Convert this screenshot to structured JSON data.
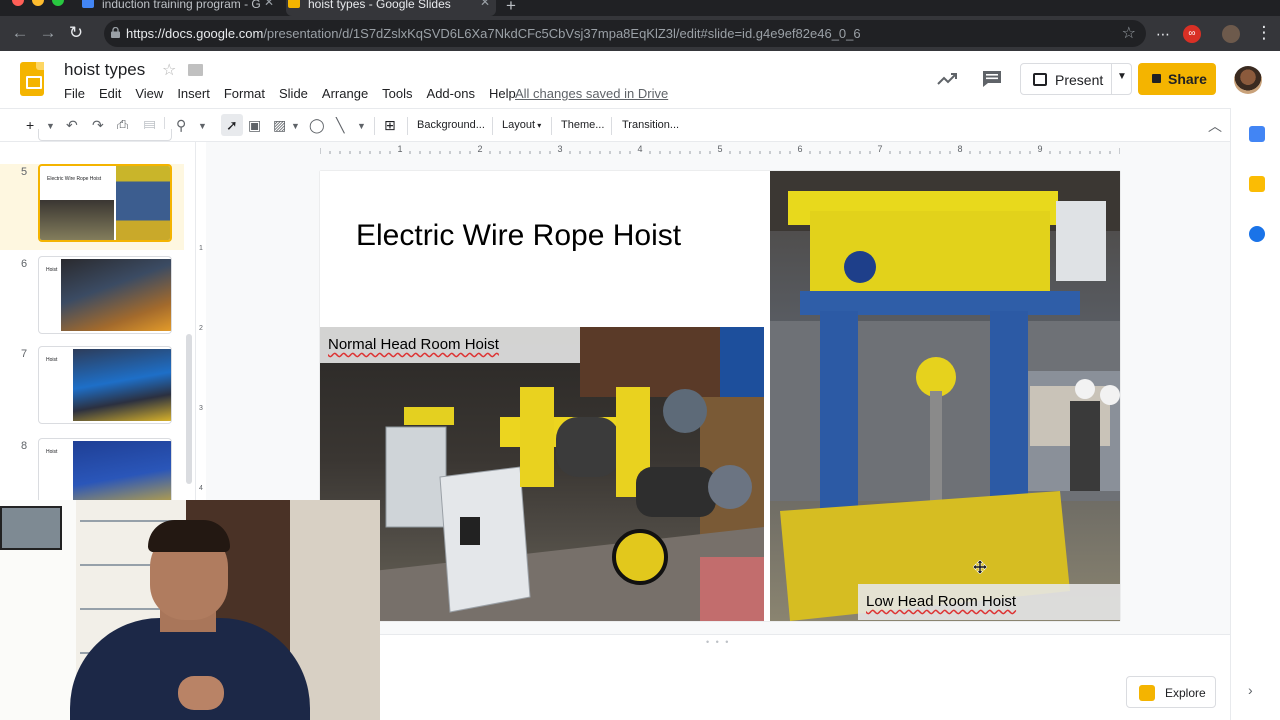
{
  "browser": {
    "tabs": [
      {
        "title": "induction training program - G",
        "active": false
      },
      {
        "title": "hoist types - Google Slides",
        "active": true
      }
    ],
    "url_host": "https://docs.google.com",
    "url_path": "/presentation/d/1S7dZslxKqSVD6L6Xa7NkdCFc5CbVsj37mpa8EqKlZ3l/edit#slide=id.g4e9ef82e46_0_6"
  },
  "app": {
    "doc_title": "hoist types",
    "menu": [
      "File",
      "Edit",
      "View",
      "Insert",
      "Format",
      "Slide",
      "Arrange",
      "Tools",
      "Add-ons",
      "Help"
    ],
    "save_status": "All changes saved in Drive",
    "present_label": "Present",
    "share_label": "Share"
  },
  "toolbar": {
    "background_label": "Background...",
    "layout_label": "Layout",
    "theme_label": "Theme...",
    "transition_label": "Transition..."
  },
  "ruler": {
    "marks": [
      "1",
      "2",
      "3",
      "4",
      "5",
      "6",
      "7",
      "8",
      "9"
    ],
    "v_marks": [
      "1",
      "2",
      "3",
      "4"
    ]
  },
  "filmstrip": {
    "slides": [
      {
        "number": "5",
        "thumb_title": "Electric Wire Rope Hoist",
        "selected": true
      },
      {
        "number": "6",
        "thumb_title": "Hoist",
        "selected": false
      },
      {
        "number": "7",
        "thumb_title": "Hoist",
        "selected": false
      },
      {
        "number": "8",
        "thumb_title": "Hoist",
        "selected": false
      }
    ]
  },
  "slide": {
    "title": "Electric Wire Rope Hoist",
    "caption_left": "Normal Head Room Hoist",
    "caption_right": "Low Head Room Hoist"
  },
  "explore_label": "Explore",
  "colors": {
    "accent": "#f4b400",
    "selected_slide_bg": "#fef7e0",
    "text": "#202124",
    "link_gray": "#5f6368"
  },
  "icons": [
    "search-icon",
    "undo-icon",
    "redo-icon",
    "print-icon",
    "zoom-icon",
    "cursor-icon",
    "textbox-icon",
    "image-icon",
    "shape-icon",
    "line-icon",
    "new-slide-icon",
    "comment-icon",
    "trend-icon",
    "calendar-icon",
    "keep-icon",
    "tasks-icon",
    "explore-icon",
    "move-cursor-icon"
  ]
}
